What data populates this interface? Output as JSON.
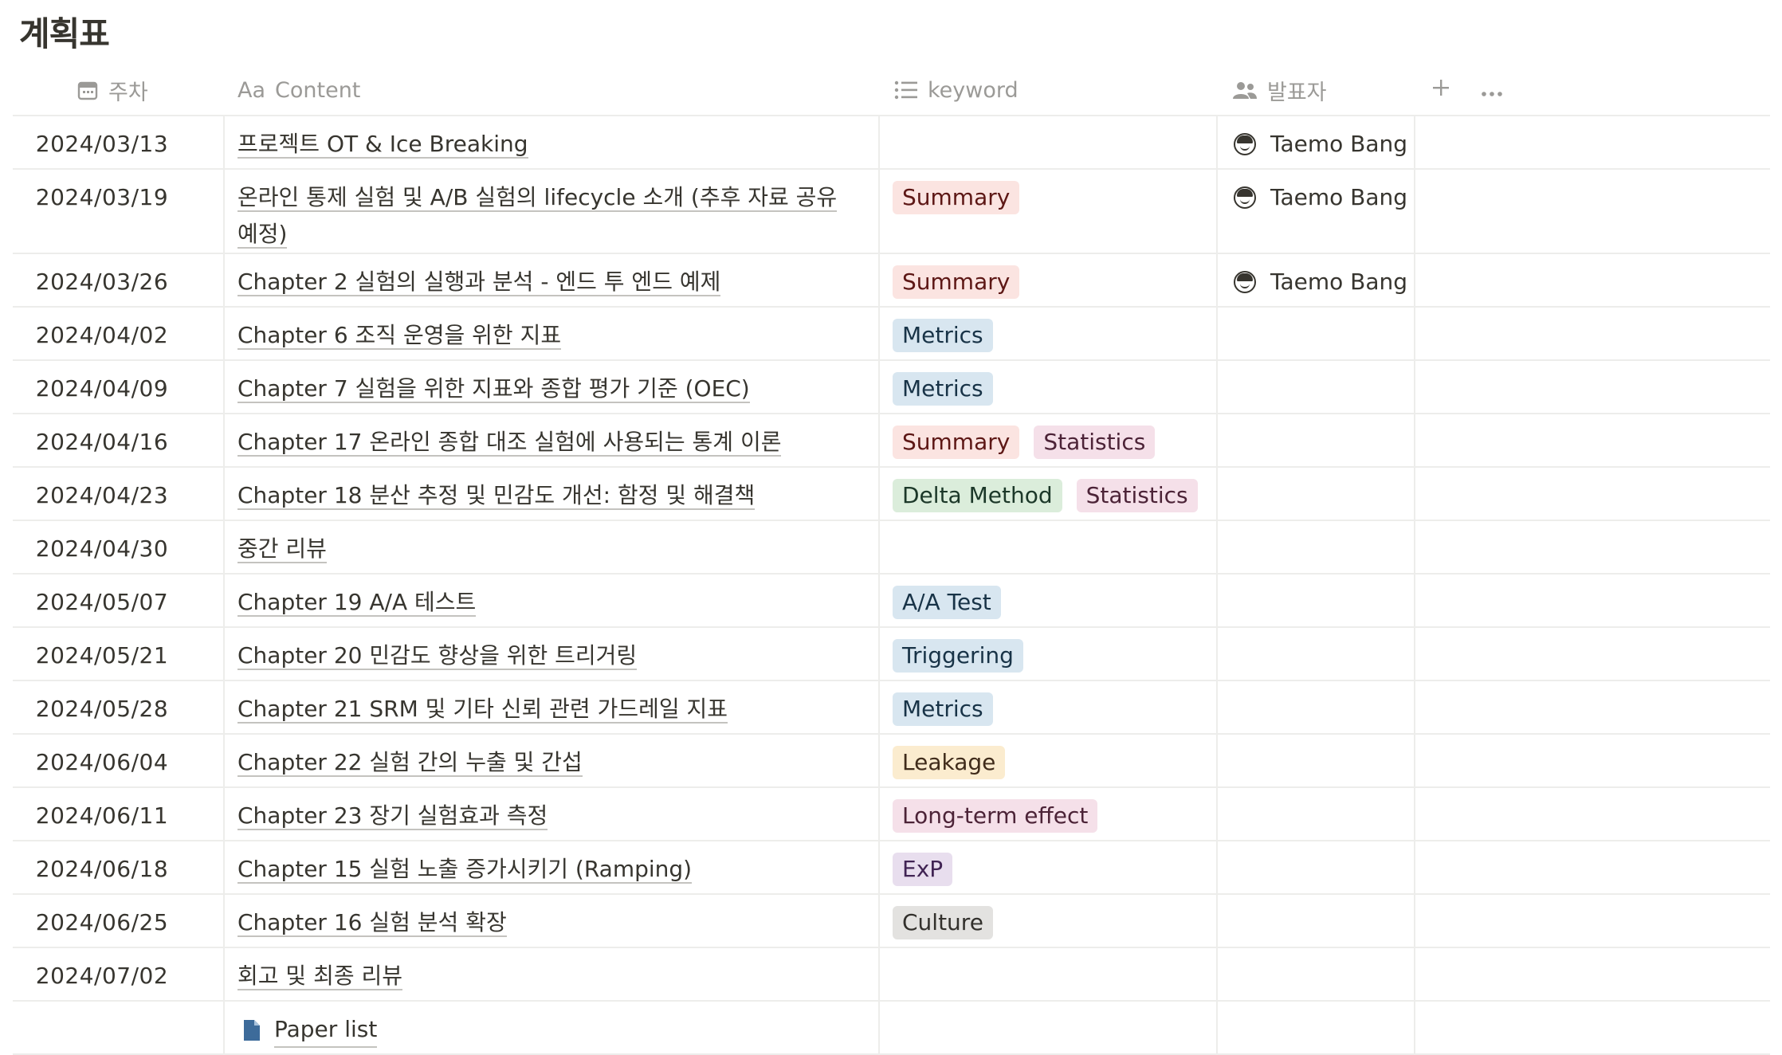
{
  "page": {
    "title": "계획표"
  },
  "columns": {
    "date": "주차",
    "content": "Content",
    "content_prefix": "Aa",
    "keyword": "keyword",
    "presenter": "발표자"
  },
  "icons": {
    "date": "calendar-icon",
    "content": "text-type-icon",
    "keyword": "list-icon",
    "presenter": "people-icon",
    "add": "plus-icon",
    "more": "more-icon"
  },
  "tag_colors": {
    "Summary": "#fbe4e1",
    "Metrics": "#d8e6f0",
    "Statistics": "#f5e0e9",
    "Delta Method": "#dbeddb",
    "A/A Test": "#d8e6f0",
    "Triggering": "#d8e6f0",
    "Leakage": "#fbeccf",
    "Long-term effect": "#f5e0e9",
    "ExP": "#e8deee",
    "Culture": "#e3e2e0"
  },
  "rows": [
    {
      "date": "2024/03/13",
      "content": "프로젝트 OT & Ice Breaking",
      "tags": [],
      "presenter": "Taemo Bang"
    },
    {
      "date": "2024/03/19",
      "content": "온라인 통제 실험 및 A/B 실험의 lifecycle 소개 (추후 자료 공유 예정)",
      "tags": [
        "Summary"
      ],
      "presenter": "Taemo Bang"
    },
    {
      "date": "2024/03/26",
      "content": "Chapter 2 실험의 실행과 분석 - 엔드 투 엔드 예제",
      "tags": [
        "Summary"
      ],
      "presenter": "Taemo Bang"
    },
    {
      "date": "2024/04/02",
      "content": "Chapter 6 조직 운영을 위한 지표",
      "tags": [
        "Metrics"
      ],
      "presenter": ""
    },
    {
      "date": "2024/04/09",
      "content": "Chapter 7 실험을 위한 지표와 종합 평가 기준 (OEC)",
      "tags": [
        "Metrics"
      ],
      "presenter": ""
    },
    {
      "date": "2024/04/16",
      "content": "Chapter 17 온라인 종합 대조 실험에 사용되는 통계 이론",
      "tags": [
        "Summary",
        "Statistics"
      ],
      "presenter": ""
    },
    {
      "date": "2024/04/23",
      "content": "Chapter 18 분산 추정 및 민감도 개선: 함정 및 해결책",
      "tags": [
        "Delta Method",
        "Statistics"
      ],
      "presenter": ""
    },
    {
      "date": "2024/04/30",
      "content": "중간 리뷰",
      "tags": [],
      "presenter": ""
    },
    {
      "date": "2024/05/07",
      "content": "Chapter 19 A/A 테스트",
      "tags": [
        "A/A Test"
      ],
      "presenter": ""
    },
    {
      "date": "2024/05/21",
      "content": "Chapter 20 민감도 향상을 위한 트리거링",
      "tags": [
        "Triggering"
      ],
      "presenter": ""
    },
    {
      "date": "2024/05/28",
      "content": "Chapter 21 SRM 및 기타 신뢰 관련 가드레일 지표",
      "tags": [
        "Metrics"
      ],
      "presenter": ""
    },
    {
      "date": "2024/06/04",
      "content": "Chapter 22 실험 간의 누출 및 간섭",
      "tags": [
        "Leakage"
      ],
      "presenter": ""
    },
    {
      "date": "2024/06/11",
      "content": "Chapter 23 장기 실험효과 측정",
      "tags": [
        "Long-term effect"
      ],
      "presenter": ""
    },
    {
      "date": "2024/06/18",
      "content": "Chapter 15 실험 노출 증가시키기 (Ramping)",
      "tags": [
        "ExP"
      ],
      "presenter": ""
    },
    {
      "date": "2024/06/25",
      "content": "Chapter 16 실험 분석 확장",
      "tags": [
        "Culture"
      ],
      "presenter": ""
    },
    {
      "date": "2024/07/02",
      "content": "회고 및 최종 리뷰",
      "tags": [],
      "presenter": ""
    },
    {
      "date": "",
      "content": "Paper list",
      "tags": [],
      "presenter": "",
      "is_page": true
    }
  ]
}
